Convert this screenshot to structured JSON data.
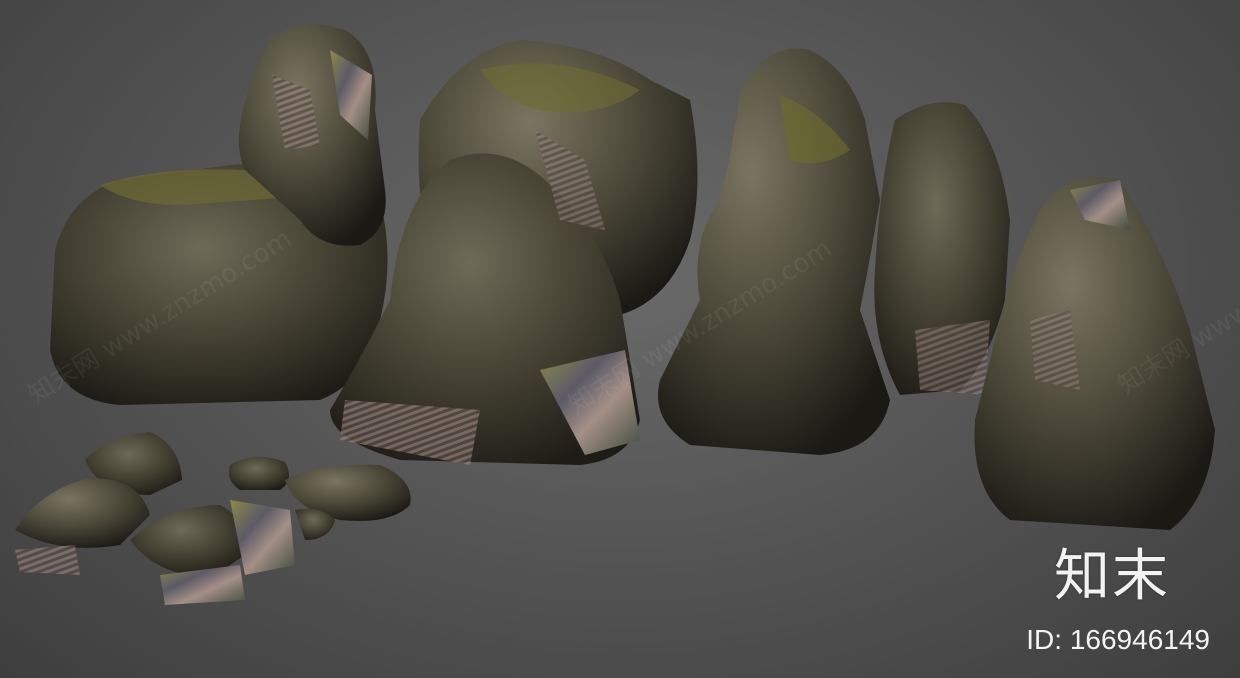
{
  "watermark": {
    "repeated_text": "知末网 www.znzmo.com"
  },
  "brand": {
    "logo_text": "知末",
    "id_text": "ID: 166946149"
  },
  "colors": {
    "background": "#565656",
    "rock_base": "#4a463c",
    "moss": "#6b6a2c",
    "texture_glitch": "#8a7d5a"
  }
}
